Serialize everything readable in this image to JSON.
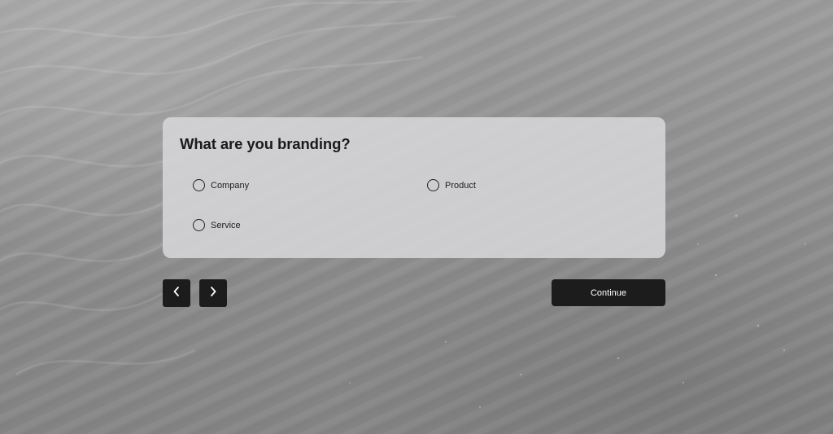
{
  "form": {
    "question": "What are you branding?",
    "options": [
      {
        "label": "Company",
        "selected": false
      },
      {
        "label": "Product",
        "selected": false
      },
      {
        "label": "Service",
        "selected": false
      }
    ]
  },
  "navigation": {
    "prev_icon": "chevron-left-icon",
    "next_icon": "chevron-right-icon",
    "continue_label": "Continue"
  },
  "theme": {
    "card_background": "#d6d5d7",
    "button_background": "#1c1c1c",
    "text_color": "#1a1a1a"
  }
}
